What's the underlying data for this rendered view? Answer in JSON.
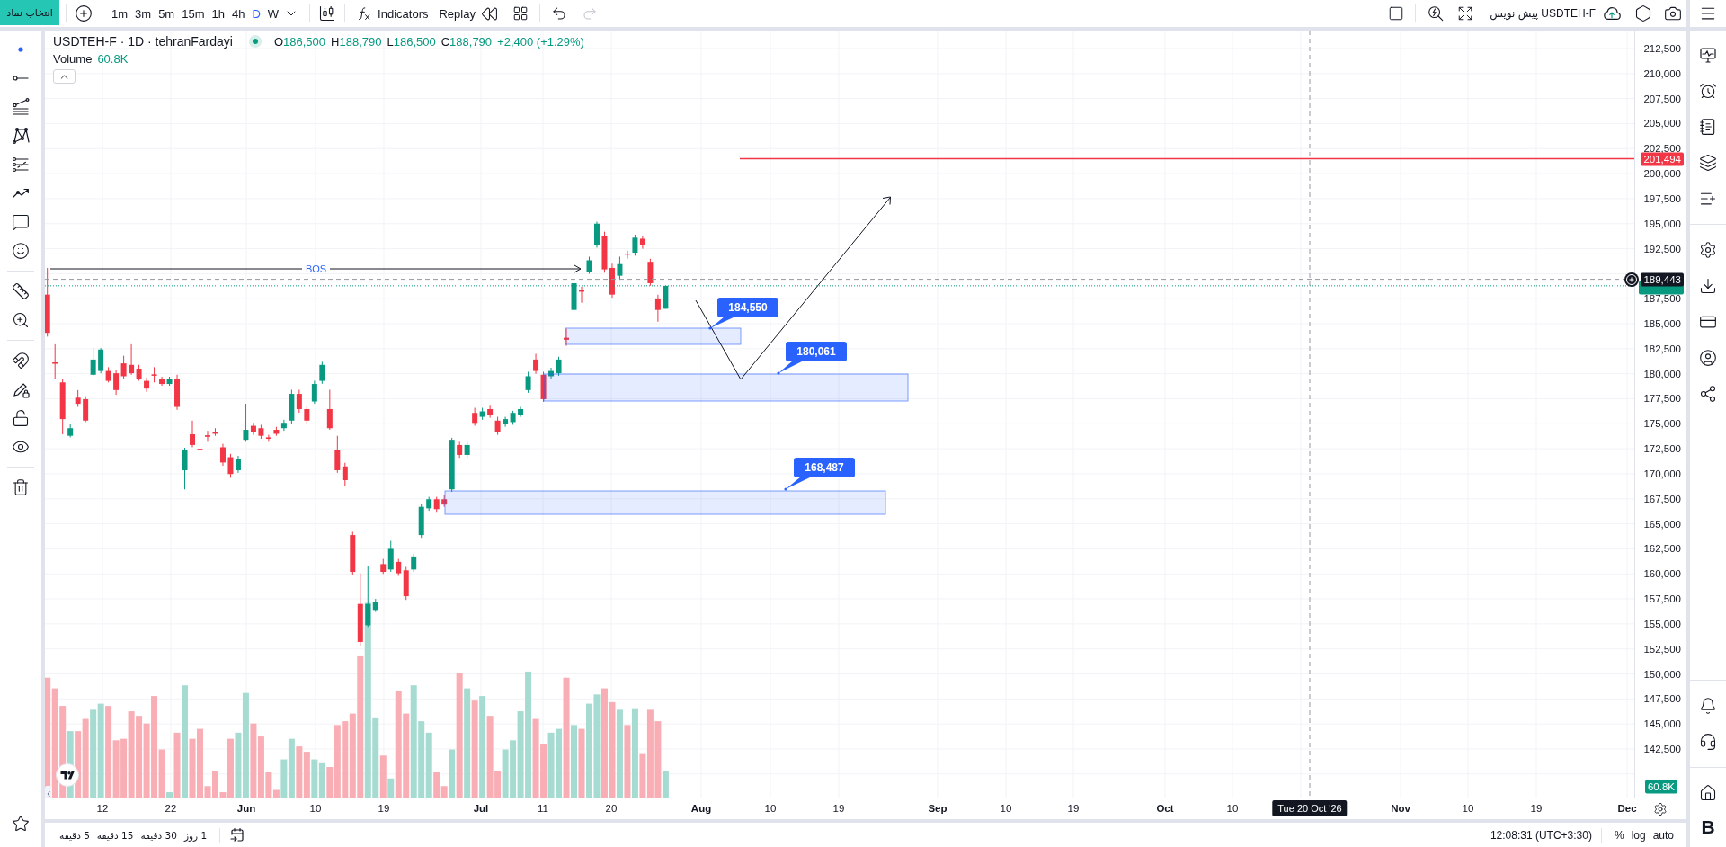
{
  "top_toolbar": {
    "symbol_search": "انتخاب نماد",
    "intervals": [
      {
        "label": "1m",
        "selected": false
      },
      {
        "label": "3m",
        "selected": false
      },
      {
        "label": "5m",
        "selected": false
      },
      {
        "label": "15m",
        "selected": false
      },
      {
        "label": "1h",
        "selected": false
      },
      {
        "label": "4h",
        "selected": false
      },
      {
        "label": "D",
        "selected": true
      },
      {
        "label": "W",
        "selected": false
      }
    ],
    "indicators": "Indicators",
    "replay": "Replay",
    "history": [
      {
        "kind": "undo",
        "disabled": false
      },
      {
        "kind": "redo",
        "disabled": true
      }
    ],
    "layout_name": "USDTEH-F پیش نویس"
  },
  "legend": {
    "title": "USDTEH-F · 1D · tehranFardayi",
    "ohlc": [
      {
        "key": "O",
        "value": "186,500"
      },
      {
        "key": "H",
        "value": "188,790"
      },
      {
        "key": "L",
        "value": "186,500"
      },
      {
        "key": "C",
        "value": "188,790"
      }
    ],
    "change": "+2,400 (+1.29%)",
    "volume_label": "Volume",
    "volume_value": "60.8K"
  },
  "chart": {
    "drawings": {
      "bos_label": "BOS",
      "callouts": [
        "184,550",
        "180,061",
        "168,487"
      ]
    },
    "price_axis": {
      "labels": [
        "212,500",
        "210,000",
        "207,500",
        "205,000",
        "202,500",
        "200,000",
        "197,500",
        "195,000",
        "192,500",
        "187,500",
        "185,000",
        "182,500",
        "180,000",
        "177,500",
        "175,000",
        "172,500",
        "170,000",
        "167,500",
        "165,000",
        "162,500",
        "160,000",
        "157,500",
        "155,000",
        "152,500",
        "150,000",
        "147,500",
        "145,000",
        "142,500"
      ],
      "alert_tag": "201,494",
      "crosshair_tag": "189,443",
      "volume_tag": "60.8K"
    },
    "time_axis": {
      "labels": [
        {
          "text": "12",
          "kind": "day"
        },
        {
          "text": "22",
          "kind": "day"
        },
        {
          "text": "Jun",
          "kind": "month"
        },
        {
          "text": "10",
          "kind": "day"
        },
        {
          "text": "19",
          "kind": "day"
        },
        {
          "text": "Jul",
          "kind": "month"
        },
        {
          "text": "11",
          "kind": "day"
        },
        {
          "text": "20",
          "kind": "day"
        },
        {
          "text": "Aug",
          "kind": "month"
        },
        {
          "text": "10",
          "kind": "day"
        },
        {
          "text": "19",
          "kind": "day"
        },
        {
          "text": "Sep",
          "kind": "month"
        },
        {
          "text": "10",
          "kind": "day"
        },
        {
          "text": "19",
          "kind": "day"
        },
        {
          "text": "Oct",
          "kind": "month"
        },
        {
          "text": "10",
          "kind": "day"
        },
        {
          "text": "Nov",
          "kind": "month"
        },
        {
          "text": "10",
          "kind": "day"
        },
        {
          "text": "19",
          "kind": "day"
        },
        {
          "text": "Dec",
          "kind": "month"
        }
      ],
      "crosshair_tag": "Tue 20 Oct '26"
    }
  },
  "bottom_bar": {
    "ranges": [
      "1 روز",
      "30 دقیقه",
      "15 دقیقه",
      "5 دقیقه"
    ],
    "clock": "12:08:31 (UTC+3:30)",
    "scale_options": [
      "%",
      "log",
      "auto"
    ]
  },
  "right_sidebar": {
    "brand_mark": "B"
  }
}
